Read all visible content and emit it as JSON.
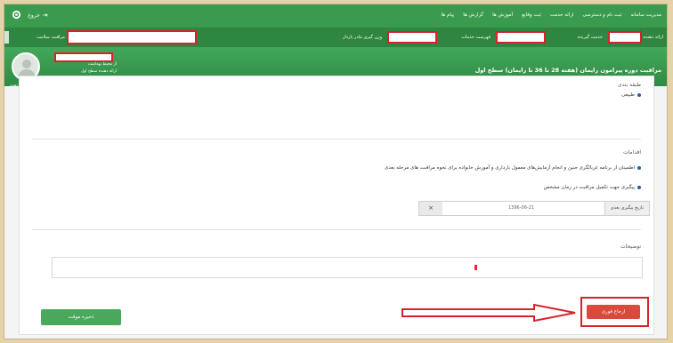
{
  "topnav": {
    "menu": [
      "مدیریت سامانه",
      "ثبت نام و دسترسی",
      "ارائه خدمت",
      "ثبت وقایع",
      "آموزش ها",
      "گزارش ها",
      "پیام ها"
    ],
    "exit_label": "خروج",
    "exit_icon": "logout-icon",
    "settings_icon": "gear-icon"
  },
  "subbar": {
    "labels": [
      "ارائه دهنده",
      "خدمت گیرنده",
      "فهرست خدمات",
      "وزن گیری مادر باردار",
      "مراقبت سلامت"
    ]
  },
  "header": {
    "title": "مراقبت دوره پیرامون زایمان (هفته 28 تا 36 تا زایمان) سطح اول",
    "user_line1": "از محیط بهداشت",
    "user_line2": "ارائه دهنده سطح اول",
    "avatar_caption": "ارائه دهنده"
  },
  "form": {
    "classification_title": "طبقه بندی",
    "classification_value": "طبیعی",
    "actions_title": "اقدامات",
    "action_1": "اطمینان از برنامه غربالگری جنین و انجام آزمایش‌های معمول بارداری و آموزش خانواده برای نحوه مراقبت های مرحله بعدی",
    "action_2": "پیگیری جهت تکمیل مراقبت در زمان مشخص",
    "date_label": "تاریخ پیگیری بعدی",
    "date_value": "1396-06-21",
    "clear_symbol": "×",
    "notes_title": "توضیحات",
    "notes_value": ""
  },
  "buttons": {
    "save_draft": "ذخیره موقت",
    "refer": "ارجاع فوری"
  },
  "colors": {
    "nav_green": "#3a9a4e",
    "sub_green": "#2f8640",
    "highlight_red": "#d6222a",
    "refer_red": "#d94a3c",
    "save_green": "#4aa85c"
  }
}
